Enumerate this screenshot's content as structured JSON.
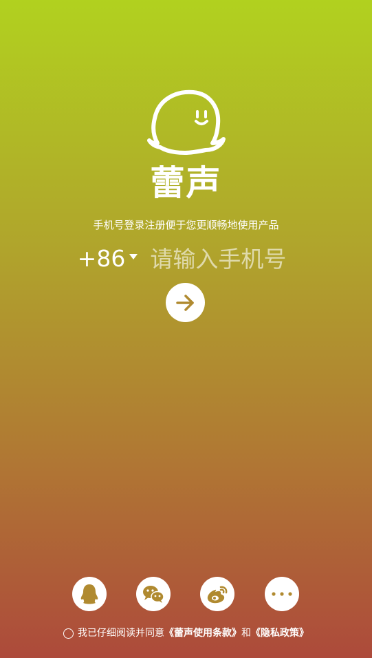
{
  "app": {
    "name": "蕾声",
    "subtitle": "手机号登录注册便于您更顺畅地使用产品"
  },
  "login": {
    "country_code": "+86",
    "phone_placeholder": "请输入手机号"
  },
  "social": [
    {
      "name": "qq",
      "icon": "qq-penguin-icon"
    },
    {
      "name": "wechat",
      "icon": "wechat-icon"
    },
    {
      "name": "weibo",
      "icon": "weibo-icon"
    },
    {
      "name": "more",
      "icon": "more-dots-icon"
    }
  ],
  "agreement": {
    "prefix": "我已仔细阅读并同意",
    "terms": "《蕾声使用条款》",
    "joiner": "和",
    "privacy": "《隐私政策》"
  },
  "colors": {
    "gradient_top": "#b1d11f",
    "gradient_bottom": "#ad4a3b",
    "icon_color": "#b08a30"
  }
}
